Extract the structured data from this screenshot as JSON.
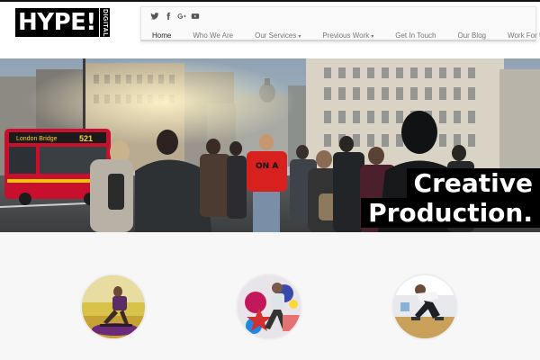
{
  "brand": {
    "logo_text": "HYPE!",
    "logo_side_text": "DIGITAL"
  },
  "social": [
    {
      "icon": "twitter-icon"
    },
    {
      "icon": "facebook-icon"
    },
    {
      "icon": "google-plus-icon"
    },
    {
      "icon": "youtube-icon"
    }
  ],
  "nav": {
    "items": [
      {
        "label": "Home",
        "active": true,
        "dropdown": false
      },
      {
        "label": "Who We Are",
        "active": false,
        "dropdown": false
      },
      {
        "label": "Our Services",
        "active": false,
        "dropdown": true
      },
      {
        "label": "Previous Work",
        "active": false,
        "dropdown": true
      },
      {
        "label": "Get In Touch",
        "active": false,
        "dropdown": false
      },
      {
        "label": "Our Blog",
        "active": false,
        "dropdown": false
      },
      {
        "label": "Work For Us",
        "active": false,
        "dropdown": false
      }
    ],
    "caret": "▾"
  },
  "hero": {
    "headline_line_1": "Creative",
    "headline_line_2": "Production.",
    "bus_destination": "London Bridge",
    "bus_route": "521",
    "shirt_text": "ON A"
  },
  "services": [
    {
      "name": "service-skateboard"
    },
    {
      "name": "service-graffiti"
    },
    {
      "name": "service-dancer"
    }
  ],
  "colors": {
    "header_bg": "#ffffff",
    "nav_panel_bg": "#fafafa",
    "nav_text": "#777777",
    "nav_active_text": "#222222",
    "headline_bg": "#000000",
    "headline_text": "#ffffff",
    "content_bg": "#f7f7f7",
    "bus_red": "#c8102e"
  }
}
